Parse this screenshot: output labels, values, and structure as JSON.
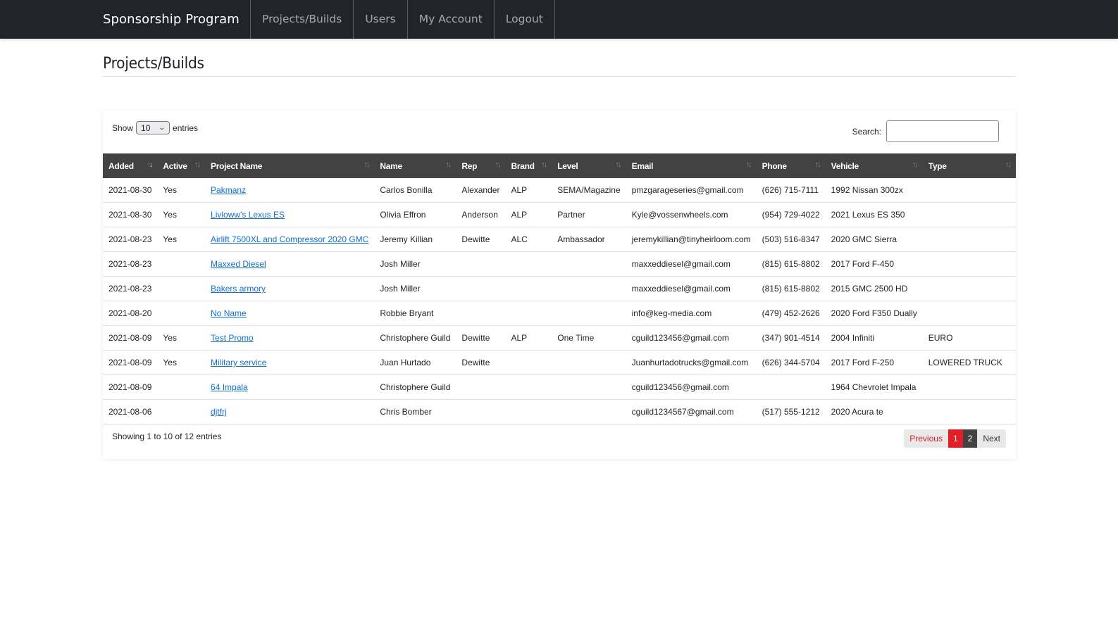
{
  "navbar": {
    "brand": "Sponsorship Program",
    "items": [
      {
        "label": "Projects/Builds"
      },
      {
        "label": "Users"
      },
      {
        "label": "My Account"
      },
      {
        "label": "Logout"
      }
    ]
  },
  "page": {
    "title": "Projects/Builds"
  },
  "table_controls": {
    "show_label": "Show",
    "entries_label": "entries",
    "page_length": "10",
    "search_label": "Search:",
    "search_value": ""
  },
  "table": {
    "sorted_column": "Added",
    "columns": [
      "Added",
      "Active",
      "Project Name",
      "Name",
      "Rep",
      "Brand",
      "Level",
      "Email",
      "Phone",
      "Vehicle",
      "Type"
    ],
    "rows": [
      {
        "added": "2021-08-30",
        "active": "Yes",
        "project": "Pakmanz",
        "name": "Carlos Bonilla",
        "rep": "Alexander",
        "brand": "ALP",
        "level": "SEMA/Magazine",
        "email": "pmzgarageseries@gmail.com",
        "phone": "(626) 715-7111",
        "vehicle": "1992 Nissan 300zx",
        "type": ""
      },
      {
        "added": "2021-08-30",
        "active": "Yes",
        "project": "Livloww's Lexus ES",
        "name": "Olivia Effron",
        "rep": "Anderson",
        "brand": "ALP",
        "level": "Partner",
        "email": "Kyle@vossenwheels.com",
        "phone": "(954) 729-4022",
        "vehicle": "2021 Lexus ES 350",
        "type": ""
      },
      {
        "added": "2021-08-23",
        "active": "Yes",
        "project": "Airlift 7500XL and Compressor 2020 GMC",
        "name": "Jeremy Killian",
        "rep": "Dewitte",
        "brand": "ALC",
        "level": "Ambassador",
        "email": "jeremykillian@tinyheirloom.com",
        "phone": "(503) 516-8347",
        "vehicle": "2020 GMC Sierra",
        "type": ""
      },
      {
        "added": "2021-08-23",
        "active": "",
        "project": "Maxxed Diesel",
        "name": "Josh Miller",
        "rep": "",
        "brand": "",
        "level": "",
        "email": "maxxeddiesel@gmail.com",
        "phone": "(815) 615-8802",
        "vehicle": "2017 Ford F-450",
        "type": ""
      },
      {
        "added": "2021-08-23",
        "active": "",
        "project": "Bakers armory",
        "name": "Josh Miller",
        "rep": "",
        "brand": "",
        "level": "",
        "email": "maxxeddiesel@gmail.com",
        "phone": "(815) 615-8802",
        "vehicle": "2015 GMC 2500 HD",
        "type": ""
      },
      {
        "added": "2021-08-20",
        "active": "",
        "project": "No Name",
        "name": "Robbie Bryant",
        "rep": "",
        "brand": "",
        "level": "",
        "email": "info@keg-media.com",
        "phone": "(479) 452-2626",
        "vehicle": "2020 Ford F350 Dually",
        "type": ""
      },
      {
        "added": "2021-08-09",
        "active": "Yes",
        "project": "Test Promo",
        "name": "Christophere Guild",
        "rep": "Dewitte",
        "brand": "ALP",
        "level": "One Time",
        "email": "cguild123456@gmail.com",
        "phone": "(347) 901-4514",
        "vehicle": "2004 Infiniti",
        "type": "EURO"
      },
      {
        "added": "2021-08-09",
        "active": "Yes",
        "project": "Military service",
        "name": "Juan Hurtado",
        "rep": "Dewitte",
        "brand": "",
        "level": "",
        "email": "Juanhurtadotrucks@gmail.com",
        "phone": "(626) 344-5704",
        "vehicle": "2017 Ford F-250",
        "type": "LOWERED TRUCK"
      },
      {
        "added": "2021-08-09",
        "active": "",
        "project": "64 Impala",
        "name": "Christophere Guild",
        "rep": "",
        "brand": "",
        "level": "",
        "email": "cguild123456@gmail.com",
        "phone": "",
        "vehicle": "1964 Chevrolet Impala",
        "type": ""
      },
      {
        "added": "2021-08-06",
        "active": "",
        "project": "djtfrj",
        "name": "Chris Bomber",
        "rep": "",
        "brand": "",
        "level": "",
        "email": "cguild1234567@gmail.com",
        "phone": "(517) 555-1212",
        "vehicle": "2020 Acura te",
        "type": ""
      }
    ]
  },
  "footer": {
    "info": "Showing 1 to 10 of 12 entries",
    "pagination": {
      "previous": "Previous",
      "pages": [
        "1",
        "2"
      ],
      "current_page": "1",
      "next": "Next"
    }
  },
  "colors": {
    "navbar_bg": "#212529",
    "table_header_bg": "#424242",
    "link": "#0d6efd",
    "accent_red": "#e31e24"
  }
}
